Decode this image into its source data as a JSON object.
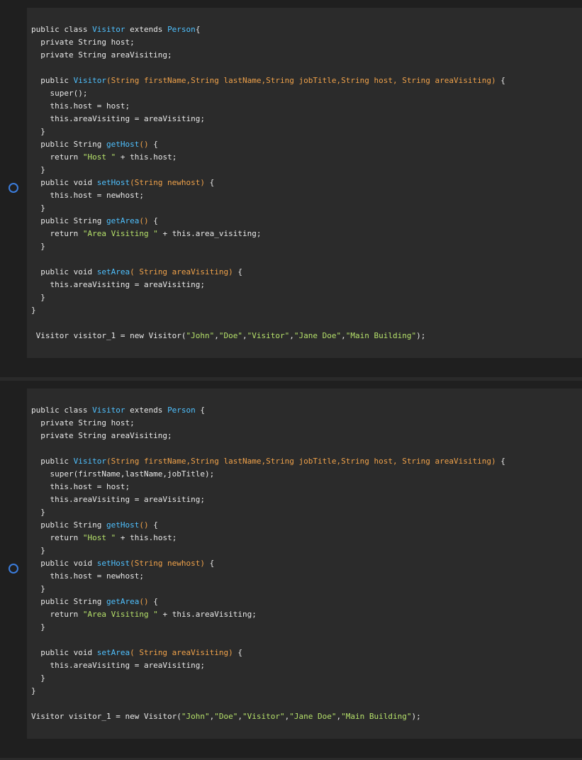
{
  "colors": {
    "background": "#1f1f1f",
    "code_background": "#2b2b2b",
    "radio": "#3b7ddd",
    "type_name": "#4fc1ff",
    "parameter": "#f0a24a",
    "string": "#b5e06a",
    "text": "#e8e8e8"
  },
  "options": [
    {
      "radio_icon": "radio-unselected-icon",
      "lines": [
        [
          [
            "plain",
            "public class "
          ],
          [
            "cls",
            "Visitor"
          ],
          [
            "plain",
            " extends "
          ],
          [
            "cls",
            "Person"
          ],
          [
            "plain",
            "{"
          ]
        ],
        [
          [
            "plain",
            "  private String host;"
          ]
        ],
        [
          [
            "plain",
            "  private String areaVisiting;"
          ]
        ],
        [],
        [
          [
            "plain",
            "  public "
          ],
          [
            "fn",
            "Visitor"
          ],
          [
            "param",
            "(String firstName,String lastName,String jobTitle,String host, String areaVisiting)"
          ],
          [
            "plain",
            " {"
          ]
        ],
        [
          [
            "plain",
            "    super();"
          ]
        ],
        [
          [
            "plain",
            "    this.host = host;"
          ]
        ],
        [
          [
            "plain",
            "    this.areaVisiting = areaVisiting;"
          ]
        ],
        [
          [
            "plain",
            "  }"
          ]
        ],
        [
          [
            "plain",
            "  public String "
          ],
          [
            "fn",
            "getHost"
          ],
          [
            "param",
            "()"
          ],
          [
            "plain",
            " {"
          ]
        ],
        [
          [
            "plain",
            "    return "
          ],
          [
            "str",
            "\"Host \""
          ],
          [
            "plain",
            " + this.host;"
          ]
        ],
        [
          [
            "plain",
            "  }"
          ]
        ],
        [
          [
            "plain",
            "  public void "
          ],
          [
            "fn",
            "setHost"
          ],
          [
            "param",
            "(String newhost)"
          ],
          [
            "plain",
            " {"
          ]
        ],
        [
          [
            "plain",
            "    this.host = newhost;"
          ]
        ],
        [
          [
            "plain",
            "  }"
          ]
        ],
        [
          [
            "plain",
            "  public String "
          ],
          [
            "fn",
            "getArea"
          ],
          [
            "param",
            "()"
          ],
          [
            "plain",
            " {"
          ]
        ],
        [
          [
            "plain",
            "    return "
          ],
          [
            "str",
            "\"Area Visiting \""
          ],
          [
            "plain",
            " + this.area_visiting;"
          ]
        ],
        [
          [
            "plain",
            "  }"
          ]
        ],
        [],
        [
          [
            "plain",
            "  public void "
          ],
          [
            "fn",
            "setArea"
          ],
          [
            "param",
            "( String areaVisiting)"
          ],
          [
            "plain",
            " {"
          ]
        ],
        [
          [
            "plain",
            "    this.areaVisiting = areaVisiting;"
          ]
        ],
        [
          [
            "plain",
            "  }"
          ]
        ],
        [
          [
            "plain",
            "}"
          ]
        ],
        [],
        [
          [
            "plain",
            " Visitor visitor_1 = new Visitor("
          ],
          [
            "str",
            "\"John\""
          ],
          [
            "plain",
            ","
          ],
          [
            "str",
            "\"Doe\""
          ],
          [
            "plain",
            ","
          ],
          [
            "str",
            "\"Visitor\""
          ],
          [
            "plain",
            ","
          ],
          [
            "str",
            "\"Jane Doe\""
          ],
          [
            "plain",
            ","
          ],
          [
            "str",
            "\"Main Building\""
          ],
          [
            "plain",
            ");"
          ]
        ]
      ]
    },
    {
      "radio_icon": "radio-unselected-icon",
      "lines": [
        [
          [
            "plain",
            "public class "
          ],
          [
            "cls",
            "Visitor"
          ],
          [
            "plain",
            " extends "
          ],
          [
            "cls",
            "Person"
          ],
          [
            "plain",
            " {"
          ]
        ],
        [
          [
            "plain",
            "  private String host;"
          ]
        ],
        [
          [
            "plain",
            "  private String areaVisiting;"
          ]
        ],
        [],
        [
          [
            "plain",
            "  public "
          ],
          [
            "fn",
            "Visitor"
          ],
          [
            "param",
            "(String firstName,String lastName,String jobTitle,String host, String areaVisiting)"
          ],
          [
            "plain",
            " {"
          ]
        ],
        [
          [
            "plain",
            "    super(firstName,lastName,jobTitle);"
          ]
        ],
        [
          [
            "plain",
            "    this.host = host;"
          ]
        ],
        [
          [
            "plain",
            "    this.areaVisiting = areaVisiting;"
          ]
        ],
        [
          [
            "plain",
            "  }"
          ]
        ],
        [
          [
            "plain",
            "  public String "
          ],
          [
            "fn",
            "getHost"
          ],
          [
            "param",
            "()"
          ],
          [
            "plain",
            " {"
          ]
        ],
        [
          [
            "plain",
            "    return "
          ],
          [
            "str",
            "\"Host \""
          ],
          [
            "plain",
            " + this.host;"
          ]
        ],
        [
          [
            "plain",
            "  }"
          ]
        ],
        [
          [
            "plain",
            "  public void "
          ],
          [
            "fn",
            "setHost"
          ],
          [
            "param",
            "(String newhost)"
          ],
          [
            "plain",
            " {"
          ]
        ],
        [
          [
            "plain",
            "    this.host = newhost;"
          ]
        ],
        [
          [
            "plain",
            "  }"
          ]
        ],
        [
          [
            "plain",
            "  public String "
          ],
          [
            "fn",
            "getArea"
          ],
          [
            "param",
            "()"
          ],
          [
            "plain",
            " {"
          ]
        ],
        [
          [
            "plain",
            "    return "
          ],
          [
            "str",
            "\"Area Visiting \""
          ],
          [
            "plain",
            " + this.areaVisiting;"
          ]
        ],
        [
          [
            "plain",
            "  }"
          ]
        ],
        [],
        [
          [
            "plain",
            "  public void "
          ],
          [
            "fn",
            "setArea"
          ],
          [
            "param",
            "( String areaVisiting)"
          ],
          [
            "plain",
            " {"
          ]
        ],
        [
          [
            "plain",
            "    this.areaVisiting = areaVisiting;"
          ]
        ],
        [
          [
            "plain",
            "  }"
          ]
        ],
        [
          [
            "plain",
            "}"
          ]
        ],
        [],
        [
          [
            "plain",
            "Visitor visitor_1 = new Visitor("
          ],
          [
            "str",
            "\"John\""
          ],
          [
            "plain",
            ","
          ],
          [
            "str",
            "\"Doe\""
          ],
          [
            "plain",
            ","
          ],
          [
            "str",
            "\"Visitor\""
          ],
          [
            "plain",
            ","
          ],
          [
            "str",
            "\"Jane Doe\""
          ],
          [
            "plain",
            ","
          ],
          [
            "str",
            "\"Main Building\""
          ],
          [
            "plain",
            ");"
          ]
        ]
      ]
    }
  ]
}
